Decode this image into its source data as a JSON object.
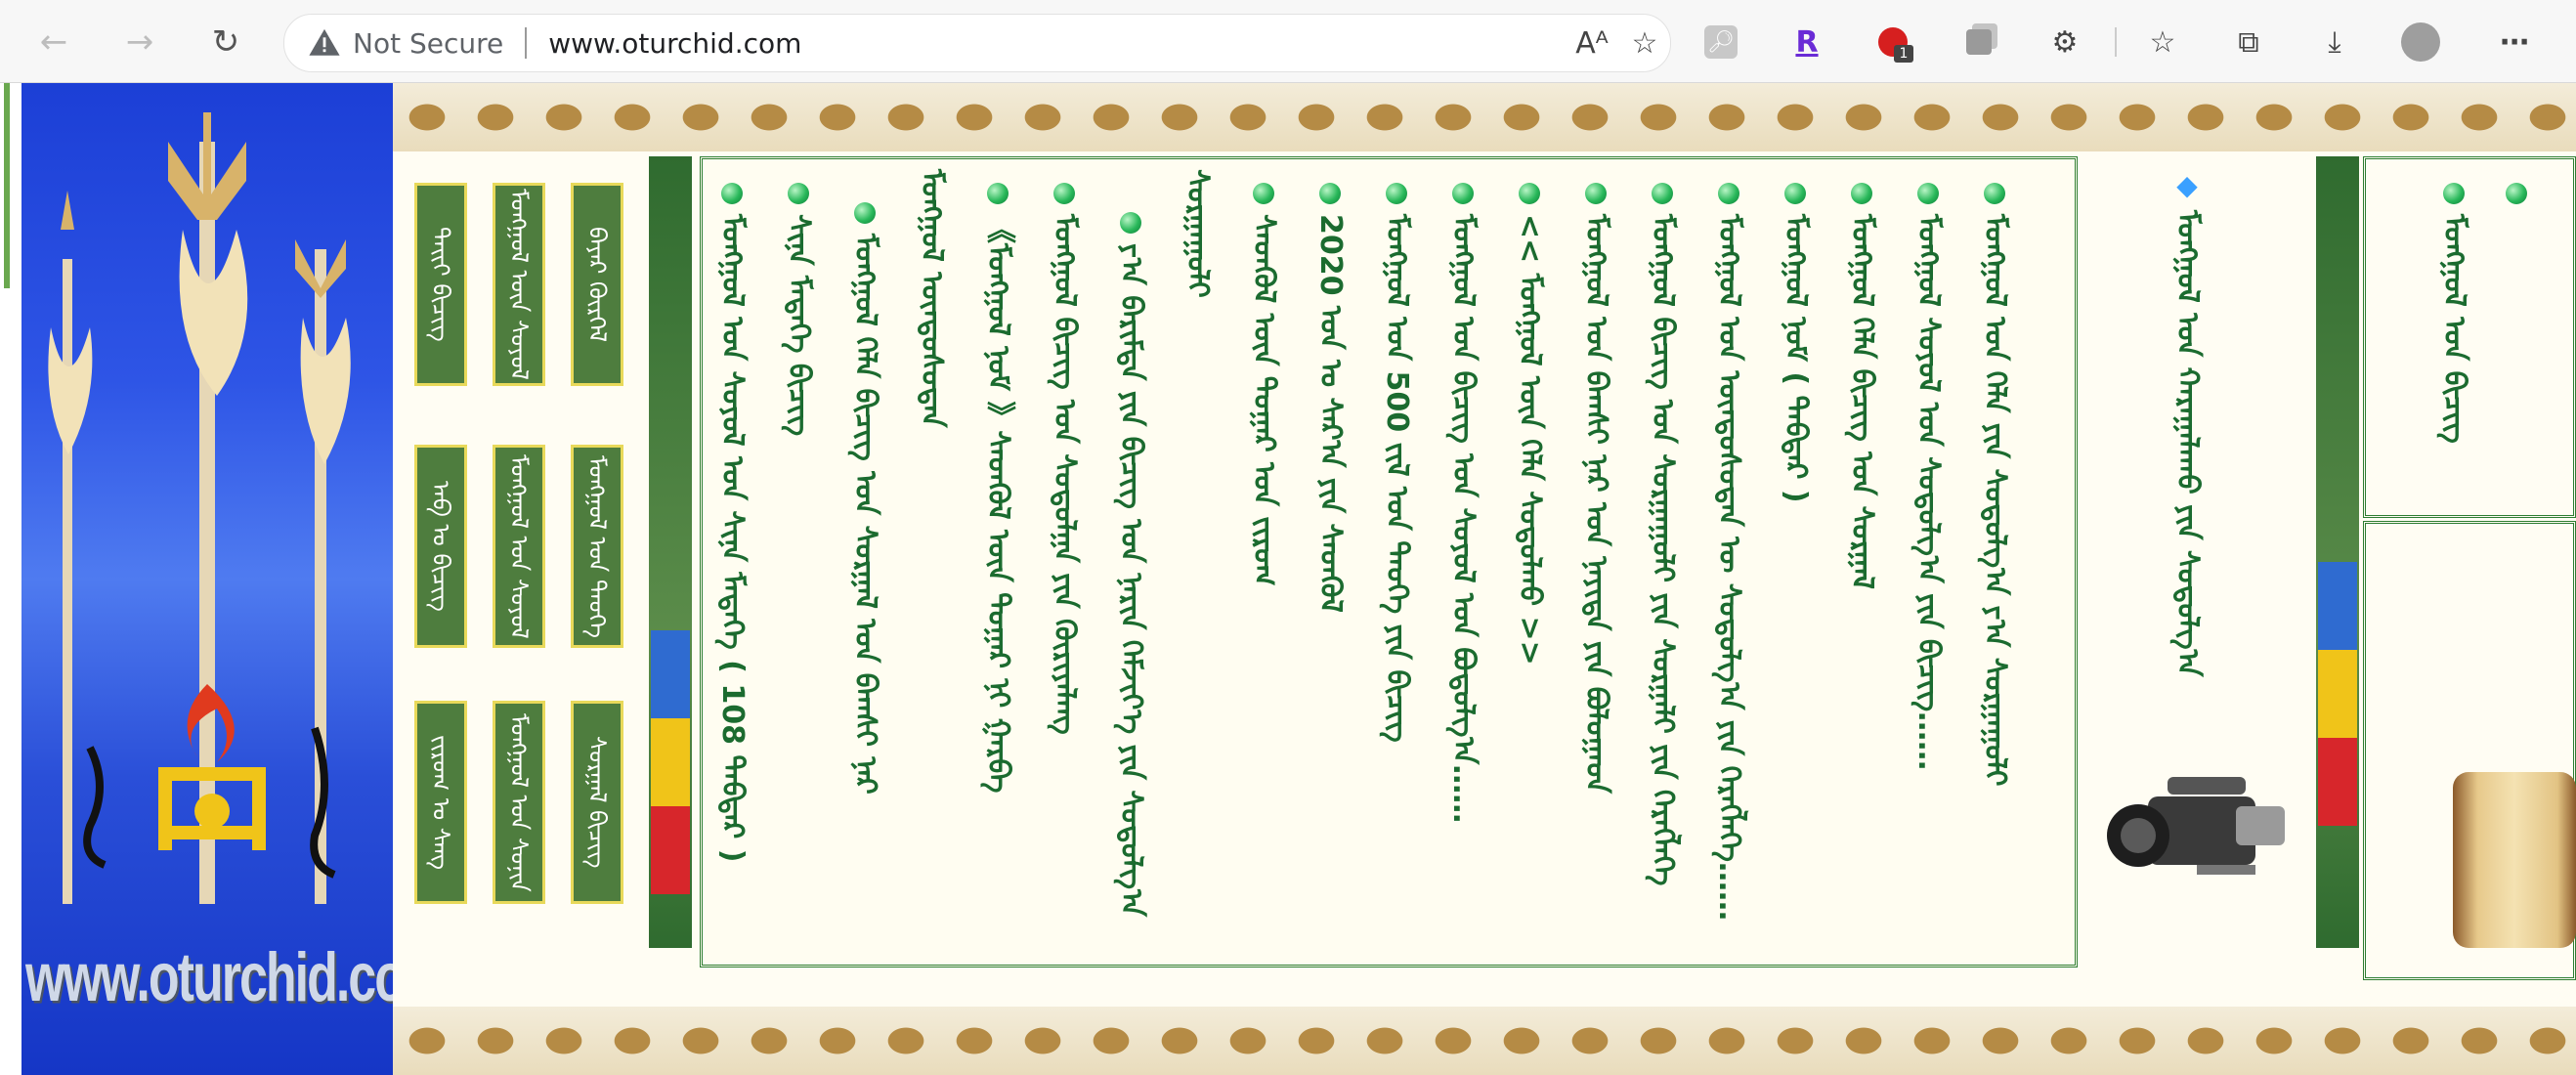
{
  "browser": {
    "back_icon": "back-arrow-icon",
    "forward_icon": "forward-arrow-icon",
    "reload_icon": "reload-icon",
    "security_label": "Not Secure",
    "url": "www.oturchid.com"
  },
  "banner": {
    "site_name": "www.oturchid.com"
  },
  "menu": {
    "items": [
      {
        "label": "ᠪᠠᠶᠠᠷ ᠬᠦᠷᠭᠡᠯ"
      },
      {
        "label": "ᠮᠣᠩᠭᠣᠯ ᠦᠨ ᠰᠣᠶᠣᠯ"
      },
      {
        "label": "ᠲᠡᠢᠢ ᠪᠢᠴᠢᠭ"
      },
      {
        "label": "ᠮᠣᠩᠭᠣᠯ ᠤᠨ ᠲᠡᠦᠬᠡ"
      },
      {
        "label": "ᠮᠣᠩᠭᠣᠯ ᠤᠨ ᠰᠣᠶᠣᠯ"
      },
      {
        "label": "ᠠᠪ ᠤ ᠪᠢᠴᠢᠭ"
      },
      {
        "label": "ᠰᠤᠷᠭᠠᠯ ᠪᠢᠴᠢᠭ"
      },
      {
        "label": "ᠮᠣᠩᠭᠣᠯ ᠤᠨ ᠰᠣᠨᠢᠨ"
      },
      {
        "label": "ᠵᠢᠷᠤᠭ ᠤ ᠰᠠᠩ"
      }
    ]
  },
  "news": {
    "items": [
      {
        "text": "ᠮᠣᠩᠭᠣᠯ ᠤᠨ ᠰᠣᠶᠣᠯ ᠤᠨ ᠰᠢᠨᠡ ᠮᠡᠳᠡᠭᠡ ( 108 ᠳᠡᠪᠲᠡᠷ )"
      },
      {
        "text": "ᠰᠢᠨᠡ ᠮᠡᠳᠡᠭᠡ ᠪᠢᠴᠢᠭ"
      },
      {
        "text": "ᠮᠣᠩᠭᠣᠯ ᠬᠡᠯᠡ ᠪᠢᠴᠢᠭ ᠤᠨ ᠰᠤᠷᠭᠠᠯ ᠤᠨ ᠪᠠᠭᠰᠢ ᠨᠠᠷ"
      },
      {
        "text": "ᠮᠣᠩᠭᠣᠯ ᠦᠨᠳᠦᠰᠦᠲᠡᠨ"
      },
      {
        "text": "《ᠮᠣᠩᠭᠣᠯ ᠨᠤᠮ 》ᠰᠡᠳᠭᠦᠯ ᠦᠨ ᠳᠤᠭᠠᠷ ᠨᠢ ᠭᠠᠷᠪᠠ"
      },
      {
        "text": "ᠮᠣᠩᠭᠣᠯ ᠪᠢᠴᠢᠭ ᠤᠨ ᠰᠤᠳᠤᠯᠭᠠ ᠶᠢᠨ ᠬᠦᠷᠢᠶᠡᠯᠡᠩ"
      },
      {
        "text": "ᠶ᠎ᠠ ᠪᠠᠷᠢᠮᠲᠠ ᠶᠢᠨ ᠪᠢᠴᠢᠭ ᠤᠨ ᠨᠠᠷᠢᠨ ᠬᠡᠮᠵᠢᠶ᠎ᠡ ᠶᠢᠨ ᠰᠤᠳᠤᠯᠭ᠎ᠠ"
      },
      {
        "text": "ᠰᠤᠷᠭᠠᠭᠤᠯᠢ"
      },
      {
        "text": "ᠰᠡᠳᠭᠦᠯ ᠦᠨ ᠳᠤᠭᠠᠷ ᠤᠨ ᠵᠢᠷᠤᠭ"
      },
      {
        "text": "2020 ᠣᠨ ᠤ ᠰᠠᠷ᠎ᠠ ᠶᠢᠨ ᠰᠡᠳᠭᠦᠯ"
      },
      {
        "text": "ᠮᠣᠩᠭᠣᠯ ᠤᠨ 500 ᠵᠢᠯ ᠤᠨ ᠲᠡᠦᠬᠡ ᠶᠢᠨ ᠪᠢᠴᠢᠭ"
      },
      {
        "text": "ᠮᠣᠩᠭᠣᠯ ᠤᠨ ᠪᠢᠴᠢᠭ ᠤᠨ ᠰᠣᠶᠣᠯ ᠤᠨ ᠪᠣᠳᠣᠯᠭ᠎ᠠ……"
      },
      {
        "text": "<< ᠮᠣᠩᠭᠣᠯ ᠦᠨ ᠬᠡᠯᠡ ᠰᠤᠳᠤᠯᠬᠤ >>"
      },
      {
        "text": "ᠮᠣᠩᠭᠣᠯ ᠤᠨ ᠪᠠᠭᠰᠢ ᠨᠠᠷ ᠤᠨ ᠨᠡᠶᠢᠲᠡ ᠶᠢᠨ ᠪᠤᠯᠤᠭᠠᠳ"
      },
      {
        "text": "ᠮᠣᠩᠭᠣᠯ ᠪᠢᠴᠢᠭ ᠤᠨ ᠰᠤᠷᠭᠠᠭᠤᠯᠢ ᠶᠢᠨ ᠰᠤᠷᠭᠠᠯᠢ ᠶᠢᠨ ᠬᠡᠷᠡᠭᠯᠡᠭᠡ"
      },
      {
        "text": "ᠮᠣᠩᠭᠣᠯ ᠤᠨ ᠦᠨᠳᠦᠰᠦᠲᠡᠨ ᠦ ᠰᠤᠳᠤᠯᠭ᠎ᠠ ᠶᠢᠨ ᠬᠡᠷᠡᠭᠯᠡᠭᠡ……"
      },
      {
        "text": "ᠮᠣᠩᠭᠣᠯ ᠨᠤᠮ ( ᠳᠡᠪᠲᠡᠷ )"
      },
      {
        "text": "ᠮᠣᠩᠭᠣᠯ ᠬᠡᠯᠡ ᠪᠢᠴᠢᠭ ᠤᠨ ᠰᠤᠷᠭᠠᠯ"
      },
      {
        "text": "ᠮᠣᠩᠭᠣᠯ ᠰᠣᠶᠣᠯ ᠤᠨ ᠰᠤᠳᠤᠯᠭ᠎ᠠ ᠶᠢᠨ ᠪᠢᠴᠢᠭ……"
      },
      {
        "text": "ᠮᠣᠩᠭᠣᠯ ᠤᠨ ᠬᠡᠯᠡ ᠶᠢᠨ ᠰᠤᠳᠤᠯᠭ᠎ᠠ ᠶ᠎ᠠ ᠰᠤᠷᠭᠠᠭᠤᠯᠢ"
      }
    ]
  },
  "video_panel": {
    "title": "ᠮᠣᠩᠭᠣᠯ ᠤᠨ ᠬᠠᠷᠠᠭᠠᠯᠠᠬᠤ ᠶᠢᠨ ᠰᠤᠳᠤᠯᠭ᠎ᠠ",
    "diamond_icon": "diamond-icon",
    "camera_icon": "video-camera-icon"
  },
  "right_panel": {
    "items": [
      {
        "text": "ᠮᠣᠩᠭᠣᠯ ᠤᠨ ᠪᠢᠴᠢᠭ"
      }
    ]
  }
}
